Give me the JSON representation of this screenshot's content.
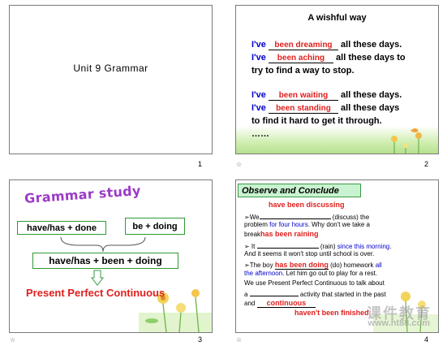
{
  "slide1": {
    "title": "Unit 9   Grammar",
    "page": "1"
  },
  "slide2": {
    "title": "A wishful way",
    "lines": [
      {
        "pre": "I've",
        "blank": "been dreaming",
        "post": "all these days."
      },
      {
        "pre": "I've",
        "blank": "been aching",
        "post": "all these days to"
      },
      {
        "cont": "try to find a way to stop."
      },
      {
        "pre": "I've",
        "blank": "been waiting",
        "post": "all these days."
      },
      {
        "pre": "I've",
        "blank": "been standing",
        "post": "all these days"
      },
      {
        "cont": "to find it hard to get it through."
      },
      {
        "cont": "……"
      }
    ],
    "page": "2",
    "marker": "☆"
  },
  "slide3": {
    "title": "Grammar study",
    "box1": "have/has + done",
    "box2": "be + doing",
    "box3": "have/has + been + doing",
    "result": "Present Perfect Continuous",
    "page": "3",
    "marker": "☆"
  },
  "slide4": {
    "header": "Observe and Conclude",
    "answer1": "have been discussing",
    "q1_a": "➢We",
    "q1_b": "(discuss)  the",
    "q1_c_black": "problem",
    "q1_c_blue": "for four hours",
    "q1_c_rest": ". Why don't we take a",
    "q1_d": "brea",
    "answer_break": "k",
    "answer2": "has been raining",
    "q2_a": "➢ It",
    "q2_b": "(rain)",
    "q2_b_blue": "since this morning",
    "q2_c": "And it seems it won't stop until school is over.",
    "q3_a": "➢The boy",
    "answer3": "has been doing",
    "q3_b": "(do) homework",
    "q3_b_blue": "all",
    "q3_c_blue": "the afternoon",
    "q3_c": ". Let him go out to play for a rest.",
    "q4_a": "We use Present Perfect Continuous to talk about",
    "q4_b_pre": "a",
    "q4_b_post": "activity that started in the past",
    "q4_c_pre": "and",
    "answer4": "continuous",
    "answer5": "haven't been finished",
    "watermark_cn": "课件教育",
    "watermark_url": "www.ht88.com",
    "page": "4",
    "marker": "☆"
  },
  "colors": {
    "accent_red": "#e0201e",
    "accent_blue": "#0000cc",
    "purple_title": "#9b3bc7",
    "box_green": "#2e9a32",
    "header_green": "#c9f3d0"
  }
}
